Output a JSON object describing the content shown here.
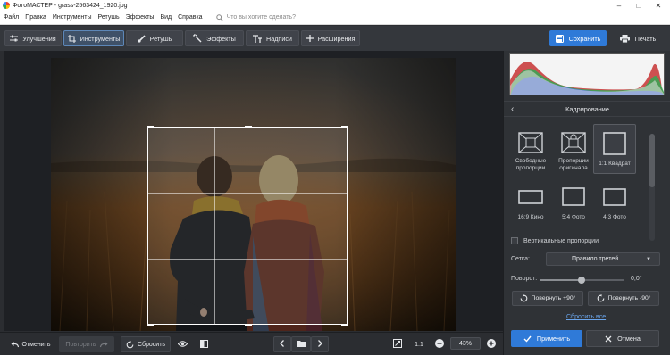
{
  "window": {
    "title": "ФотоМАСТЕР - grass-2563424_1920.jpg",
    "controls": {
      "minimize": "–",
      "maximize": "□",
      "close": "✕"
    }
  },
  "menu": {
    "items": [
      "Файл",
      "Правка",
      "Инструменты",
      "Ретушь",
      "Эффекты",
      "Вид",
      "Справка"
    ],
    "search_placeholder": "Что вы хотите сделать?"
  },
  "toolbar": {
    "tabs": [
      {
        "label": "Улучшения",
        "icon": "sliders-icon",
        "active": false
      },
      {
        "label": "Инструменты",
        "icon": "crop-icon",
        "active": true
      },
      {
        "label": "Ретушь",
        "icon": "brush-icon",
        "active": false
      },
      {
        "label": "Эффекты",
        "icon": "magic-wand-icon",
        "active": false
      },
      {
        "label": "Надписи",
        "icon": "text-icon",
        "active": false
      },
      {
        "label": "Расширения",
        "icon": "plus-icon",
        "active": false
      }
    ],
    "save_label": "Сохранить",
    "print_label": "Печать"
  },
  "panel": {
    "section_title": "Кадрирование",
    "presets": [
      {
        "label": "Свободные пропорции",
        "line1": "Свободные",
        "line2": "пропорции",
        "icon": "free-crop-icon",
        "selected": false
      },
      {
        "label": "Пропорции оригинала",
        "line1": "Пропорции",
        "line2": "оригинала",
        "icon": "lock-ratio-icon",
        "selected": false
      },
      {
        "label": "1:1 Квадрат",
        "line1": "1:1 Квадрат",
        "line2": "",
        "icon": "square-icon",
        "selected": true
      },
      {
        "label": "16:9 Кино",
        "icon": "ratio-16-9-icon",
        "selected": false
      },
      {
        "label": "5:4 Фото",
        "icon": "ratio-5-4-icon",
        "selected": false
      },
      {
        "label": "4:3 Фото",
        "icon": "ratio-4-3-icon",
        "selected": false
      }
    ],
    "vertical_label": "Вертикальные пропорции",
    "vertical_checked": false,
    "grid_label": "Сетка:",
    "grid_value": "Правило третей",
    "rotation_label": "Поворот:",
    "rotation_value": "0,0°",
    "rotation_level": 0.5,
    "rotate_cw_label": "Повернуть +90°",
    "rotate_ccw_label": "Повернуть -90°",
    "reset_all_label": "Сбросить все",
    "apply_label": "Применить",
    "cancel_label": "Отмена"
  },
  "bottom": {
    "undo_label": "Отменить",
    "redo_label": "Повторить",
    "reset_label": "Сбросить",
    "actual_size_label": "1:1",
    "zoom_value": "43%"
  },
  "colors": {
    "accent": "#2f7ad8",
    "panel_bg": "#2f3236",
    "toolbar_bg": "#34373c",
    "link": "#6aa5ec"
  }
}
